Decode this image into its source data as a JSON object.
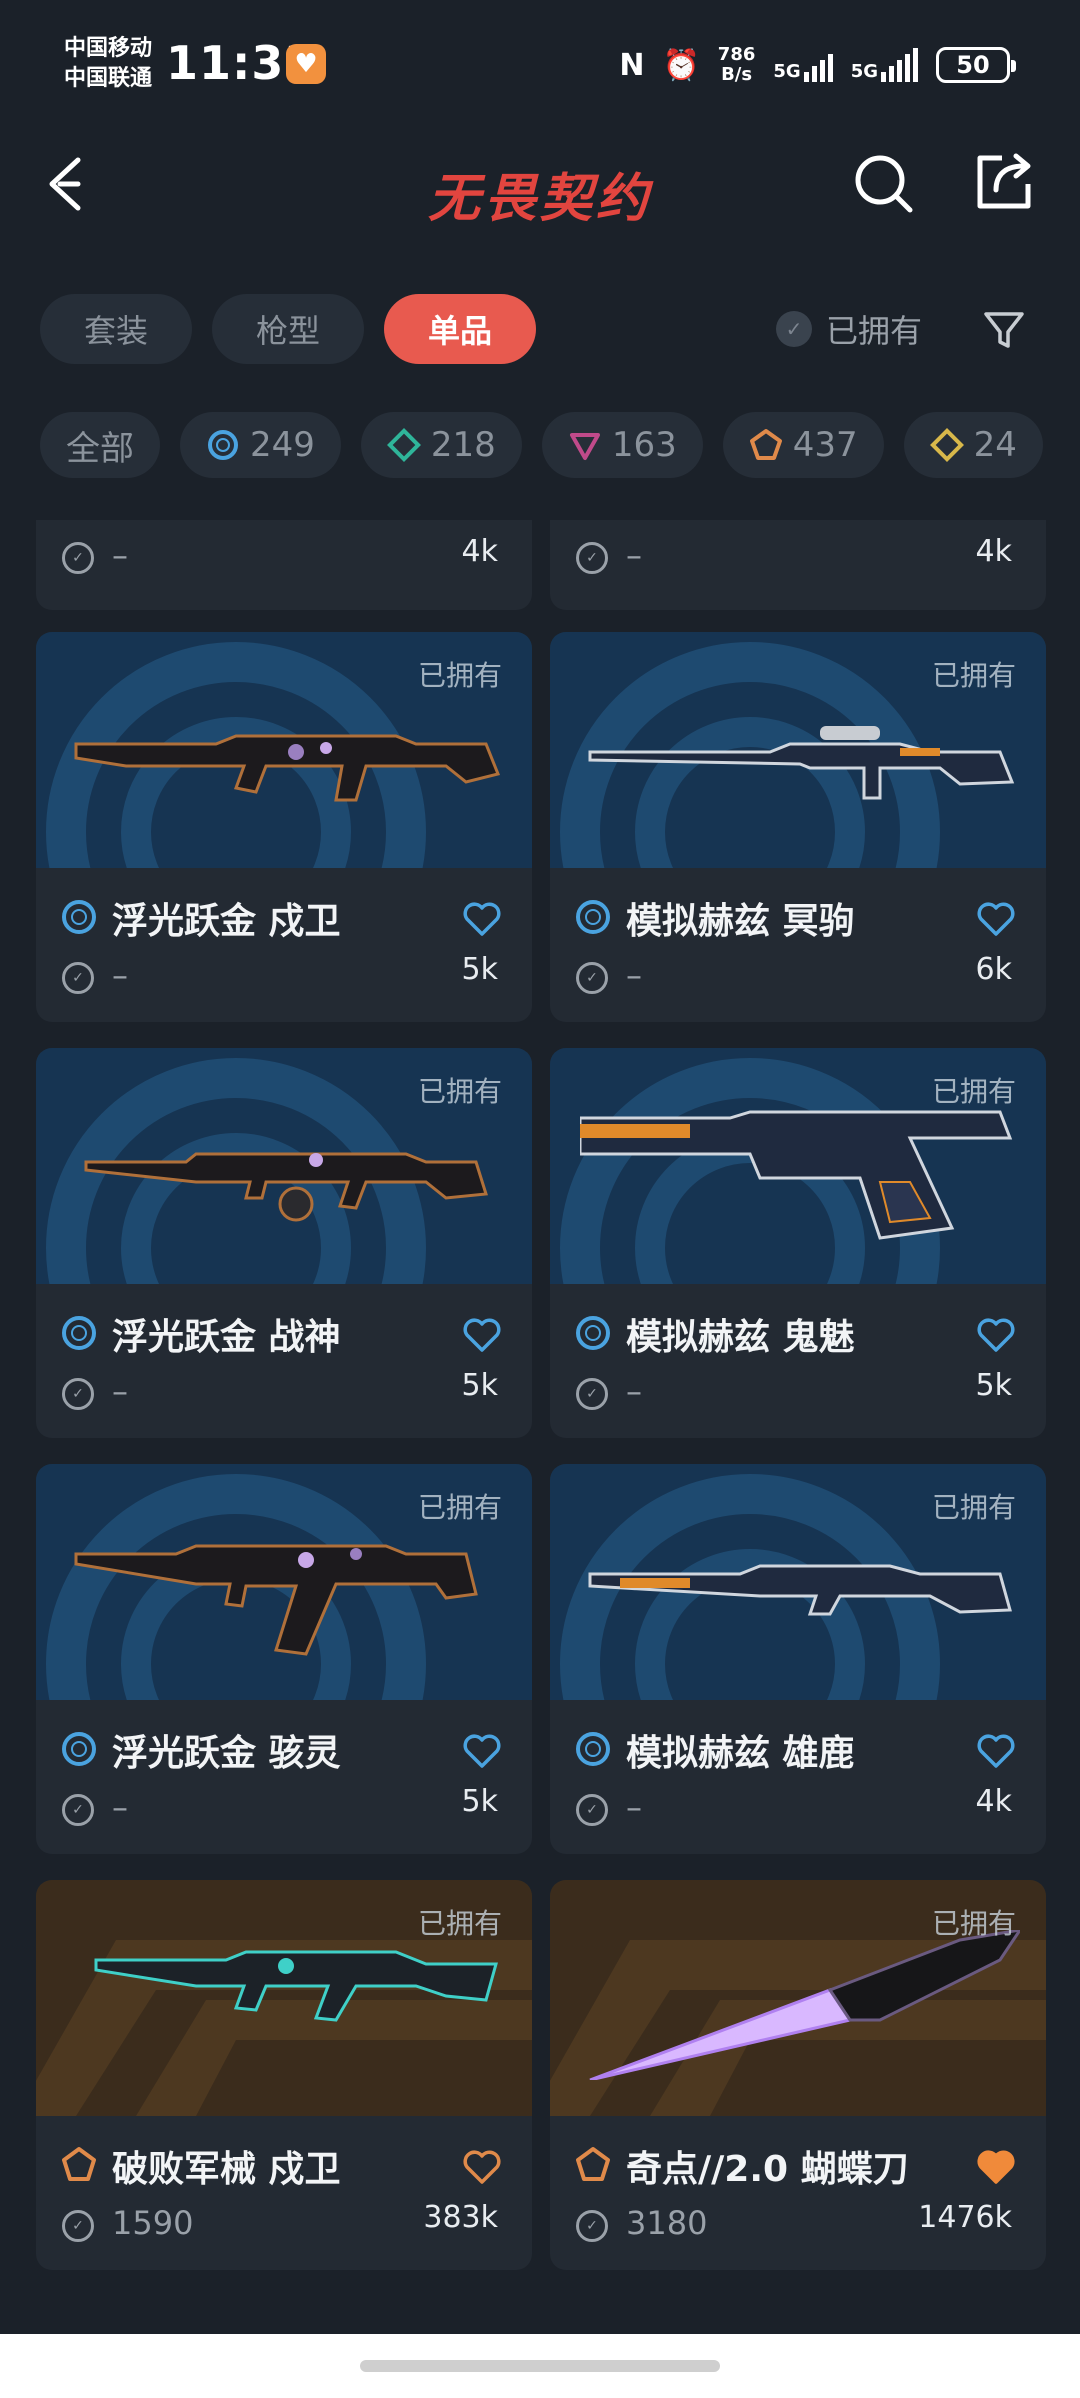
{
  "status_bar": {
    "carrier_1": "中国移动",
    "carrier_2": "中国联通",
    "time": "11:33",
    "net_speed_value": "786",
    "net_speed_unit": "B/s",
    "signal_1": "5G",
    "signal_2": "5G",
    "battery": "50"
  },
  "header": {
    "title": "无畏契约"
  },
  "tabs": [
    {
      "label": "套装"
    },
    {
      "label": "枪型"
    },
    {
      "label": "单品"
    }
  ],
  "owned_filter_label": "已拥有",
  "rarity_chips": [
    {
      "label": "全部"
    },
    {
      "label": "249",
      "color": "#4aa3e0"
    },
    {
      "label": "218",
      "color": "#2fb59a"
    },
    {
      "label": "163",
      "color": "#c04a8a"
    },
    {
      "label": "437",
      "color": "#e08a4a"
    },
    {
      "label": "24",
      "color": "#d8b84a"
    }
  ],
  "items": [
    {
      "name": "",
      "price": "–",
      "likes": "4k"
    },
    {
      "name": "",
      "price": "–",
      "likes": "4k"
    },
    {
      "name": "浮光跃金 戍卫",
      "price": "–",
      "likes": "5k",
      "owned": "已拥有",
      "tier_color": "#4aa3e0"
    },
    {
      "name": "模拟赫兹 冥驹",
      "price": "–",
      "likes": "6k",
      "owned": "已拥有",
      "tier_color": "#4aa3e0"
    },
    {
      "name": "浮光跃金 战神",
      "price": "–",
      "likes": "5k",
      "owned": "已拥有",
      "tier_color": "#4aa3e0"
    },
    {
      "name": "模拟赫兹 鬼魅",
      "price": "–",
      "likes": "5k",
      "owned": "已拥有",
      "tier_color": "#4aa3e0"
    },
    {
      "name": "浮光跃金 骇灵",
      "price": "–",
      "likes": "5k",
      "owned": "已拥有",
      "tier_color": "#4aa3e0"
    },
    {
      "name": "模拟赫兹 雄鹿",
      "price": "–",
      "likes": "4k",
      "owned": "已拥有",
      "tier_color": "#4aa3e0"
    },
    {
      "name": "破败军械 戍卫",
      "price": "1590",
      "likes": "383k",
      "owned": "已拥有",
      "tier_color": "#e08a4a"
    },
    {
      "name": "奇点//2.0 蝴蝶刀",
      "price": "3180",
      "likes": "1476k",
      "owned": "已拥有",
      "tier_color": "#e08a4a"
    }
  ],
  "colors": {
    "accent": "#e85a4f",
    "title_red": "#e2453f",
    "select_blue": "#4aa3e0",
    "exclusive_orange": "#e08a4a",
    "background": "#1b2129"
  }
}
